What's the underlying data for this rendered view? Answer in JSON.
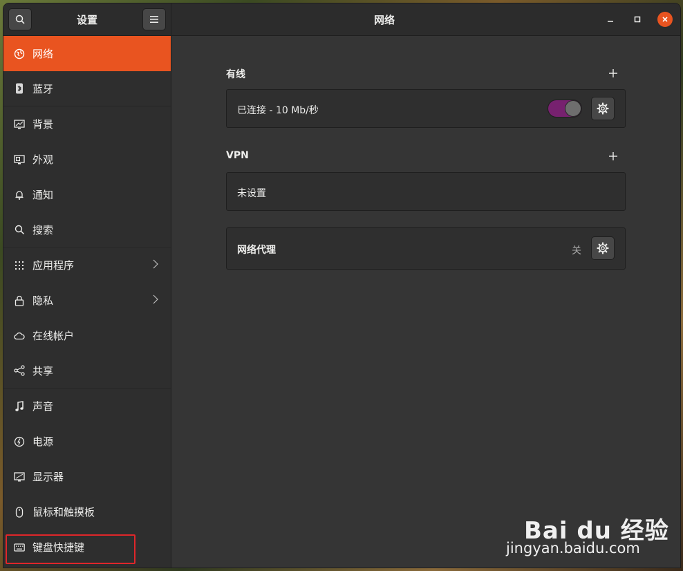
{
  "header": {
    "left_title": "设置",
    "main_title": "网络"
  },
  "sidebar": {
    "items": [
      {
        "label": "网络",
        "icon": "network-globe-icon",
        "active": true
      },
      {
        "label": "蓝牙",
        "icon": "bluetooth-icon"
      },
      {
        "label": "背景",
        "icon": "background-monitor-icon"
      },
      {
        "label": "外观",
        "icon": "appearance-icon"
      },
      {
        "label": "通知",
        "icon": "bell-icon"
      },
      {
        "label": "搜索",
        "icon": "search-icon"
      },
      {
        "label": "应用程序",
        "icon": "apps-grid-icon",
        "chevron": true
      },
      {
        "label": "隐私",
        "icon": "lock-icon",
        "chevron": true
      },
      {
        "label": "在线帐户",
        "icon": "cloud-icon"
      },
      {
        "label": "共享",
        "icon": "share-icon"
      },
      {
        "label": "声音",
        "icon": "music-note-icon"
      },
      {
        "label": "电源",
        "icon": "power-icon"
      },
      {
        "label": "显示器",
        "icon": "display-icon"
      },
      {
        "label": "鼠标和触摸板",
        "icon": "mouse-icon"
      },
      {
        "label": "键盘快捷键",
        "icon": "keyboard-icon"
      }
    ]
  },
  "wired": {
    "title": "有线",
    "status": "已连接 - 10 Mb/秒",
    "toggle_on": true
  },
  "vpn": {
    "title": "VPN",
    "status": "未设置"
  },
  "proxy": {
    "title": "网络代理",
    "state": "关"
  },
  "colors": {
    "accent": "#e95420",
    "toggle_on": "#77216f",
    "highlight_box": "#e0262a"
  },
  "watermark": {
    "line1": "Bai du 经验",
    "line2": "jingyan.baidu.com"
  }
}
